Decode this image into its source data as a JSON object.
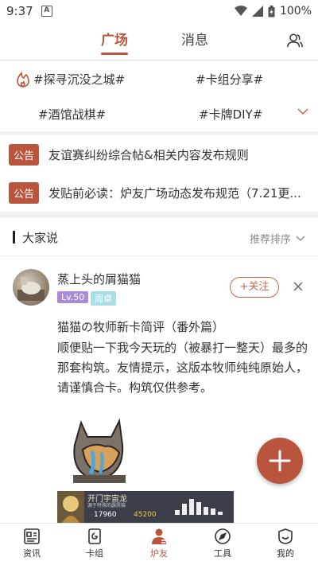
{
  "status_bar": {
    "time": "9:37",
    "battery": "100%"
  },
  "top_tabs": [
    {
      "label": "广场",
      "active": true
    },
    {
      "label": "消息",
      "active": false
    }
  ],
  "topics": [
    "#探寻沉没之城#",
    "#卡组分享#",
    "#酒馆战棋#",
    "#卡牌DIY#"
  ],
  "notices": [
    {
      "badge": "公告",
      "text": "友谊赛纠纷综合帖&相关内容发布规则"
    },
    {
      "badge": "公告",
      "text": "发贴前必读：炉友广场动态发布规范（7.21更..."
    }
  ],
  "section": {
    "title": "大家说",
    "sort_label": "推荐排序"
  },
  "post": {
    "username": "蒸上头的屑猫猫",
    "level": "Lv.50",
    "tag": "周卓",
    "follow_label": "+关注",
    "title": "猫猫の牧师新卡简评（番外篇）",
    "body": "顺便贴一下我今天玩的（被暴打一整天）最多的那套构筑。友情提示，这版本牧师纯纯原始人，请谨慎合卡。构筑仅供参考。",
    "banner": {
      "title": "开门宇宙龙",
      "subtitle": "源于特殊的霹雳猫",
      "num1": "17960",
      "num2": "45200"
    }
  },
  "bottom_nav": [
    {
      "label": "资讯",
      "icon": "news-icon",
      "active": false
    },
    {
      "label": "卡组",
      "icon": "deck-icon",
      "active": false
    },
    {
      "label": "炉友",
      "icon": "friends-icon",
      "active": true
    },
    {
      "label": "工具",
      "icon": "compass-icon",
      "active": false
    },
    {
      "label": "我的",
      "icon": "profile-icon",
      "active": false
    }
  ],
  "colors": {
    "accent": "#b9553c",
    "level_badge": "#a98bd8",
    "tag_badge": "#a9dfe4"
  }
}
